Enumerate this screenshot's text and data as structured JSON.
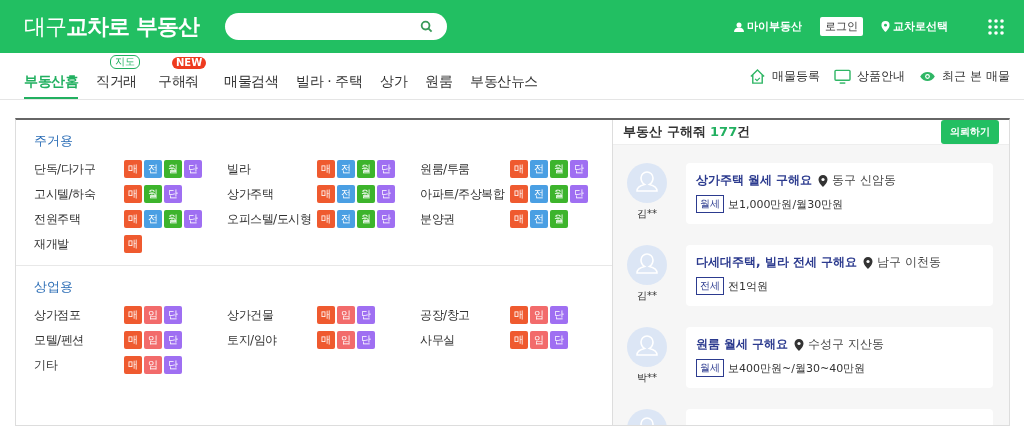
{
  "header": {
    "logo": "대구**교차로 부동산**",
    "links": [
      {
        "kind": "user",
        "label": "마이부동산"
      },
      {
        "kind": "login",
        "label": "로그인"
      },
      {
        "kind": "location",
        "label": "교차로선택"
      }
    ]
  },
  "nav": {
    "tabs": [
      {
        "label": "부동산홈",
        "selected": true
      },
      {
        "label": "직거래",
        "selected": false,
        "badge": {
          "kind": "outline",
          "text": "지도"
        }
      },
      {
        "label": "구해줘",
        "selected": false,
        "badge": {
          "kind": "new",
          "text": "NEW"
        }
      },
      {
        "label": "매물검색",
        "selected": false
      },
      {
        "label": "빌라 · 주택",
        "selected": false
      },
      {
        "label": "상가",
        "selected": false
      },
      {
        "label": "원룸",
        "selected": false
      },
      {
        "label": "부동산뉴스",
        "selected": false
      }
    ],
    "actions": [
      {
        "kind": "house",
        "label": "매물등록"
      },
      {
        "kind": "monitor",
        "label": "상품안내"
      },
      {
        "kind": "eye",
        "label": "최근 본 매물"
      }
    ]
  },
  "categories": [
    {
      "title": "주거용",
      "items": [
        {
          "label": "단독/다가구",
          "tags": [
            {
              "label": "매",
              "color": "#ef5a2f"
            },
            {
              "label": "전",
              "color": "#4a9fe3"
            },
            {
              "label": "월",
              "color": "#3db42c"
            },
            {
              "label": "단",
              "color": "#9f6ff2"
            }
          ]
        },
        {
          "label": "빌라",
          "tags": [
            {
              "label": "매",
              "color": "#ef5a2f"
            },
            {
              "label": "전",
              "color": "#4a9fe3"
            },
            {
              "label": "월",
              "color": "#3db42c"
            },
            {
              "label": "단",
              "color": "#9f6ff2"
            }
          ]
        },
        {
          "label": "원룸/투룸",
          "tags": [
            {
              "label": "매",
              "color": "#ef5a2f"
            },
            {
              "label": "전",
              "color": "#4a9fe3"
            },
            {
              "label": "월",
              "color": "#3db42c"
            },
            {
              "label": "단",
              "color": "#9f6ff2"
            }
          ]
        },
        {
          "label": "고시텔/하숙",
          "tags": [
            {
              "label": "매",
              "color": "#ef5a2f"
            },
            {
              "label": "월",
              "color": "#3db42c"
            },
            {
              "label": "단",
              "color": "#9f6ff2"
            }
          ]
        },
        {
          "label": "상가주택",
          "tags": [
            {
              "label": "매",
              "color": "#ef5a2f"
            },
            {
              "label": "전",
              "color": "#4a9fe3"
            },
            {
              "label": "월",
              "color": "#3db42c"
            },
            {
              "label": "단",
              "color": "#9f6ff2"
            }
          ]
        },
        {
          "label": "아파트/주상복합",
          "tags": [
            {
              "label": "매",
              "color": "#ef5a2f"
            },
            {
              "label": "전",
              "color": "#4a9fe3"
            },
            {
              "label": "월",
              "color": "#3db42c"
            },
            {
              "label": "단",
              "color": "#9f6ff2"
            }
          ]
        },
        {
          "label": "전원주택",
          "tags": [
            {
              "label": "매",
              "color": "#ef5a2f"
            },
            {
              "label": "전",
              "color": "#4a9fe3"
            },
            {
              "label": "월",
              "color": "#3db42c"
            },
            {
              "label": "단",
              "color": "#9f6ff2"
            }
          ]
        },
        {
          "label": "오피스텔/도시형",
          "tags": [
            {
              "label": "매",
              "color": "#ef5a2f"
            },
            {
              "label": "전",
              "color": "#4a9fe3"
            },
            {
              "label": "월",
              "color": "#3db42c"
            },
            {
              "label": "단",
              "color": "#9f6ff2"
            }
          ]
        },
        {
          "label": "분양권",
          "tags": [
            {
              "label": "매",
              "color": "#ef5a2f"
            },
            {
              "label": "전",
              "color": "#4a9fe3"
            },
            {
              "label": "월",
              "color": "#3db42c"
            }
          ]
        },
        {
          "label": "재개발",
          "tags": [
            {
              "label": "매",
              "color": "#ef5a2f"
            }
          ]
        }
      ]
    },
    {
      "title": "상업용",
      "items": [
        {
          "label": "상가점포",
          "tags": [
            {
              "label": "매",
              "color": "#ef5a2f"
            },
            {
              "label": "임",
              "color": "#f26b6b"
            },
            {
              "label": "단",
              "color": "#9f6ff2"
            }
          ]
        },
        {
          "label": "상가건물",
          "tags": [
            {
              "label": "매",
              "color": "#ef5a2f"
            },
            {
              "label": "임",
              "color": "#f26b6b"
            },
            {
              "label": "단",
              "color": "#9f6ff2"
            }
          ]
        },
        {
          "label": "공장/창고",
          "tags": [
            {
              "label": "매",
              "color": "#ef5a2f"
            },
            {
              "label": "임",
              "color": "#f26b6b"
            },
            {
              "label": "단",
              "color": "#9f6ff2"
            }
          ]
        },
        {
          "label": "모텔/펜션",
          "tags": [
            {
              "label": "매",
              "color": "#ef5a2f"
            },
            {
              "label": "임",
              "color": "#f26b6b"
            },
            {
              "label": "단",
              "color": "#9f6ff2"
            }
          ]
        },
        {
          "label": "토지/임야",
          "tags": [
            {
              "label": "매",
              "color": "#ef5a2f"
            },
            {
              "label": "임",
              "color": "#f26b6b"
            },
            {
              "label": "단",
              "color": "#9f6ff2"
            }
          ]
        },
        {
          "label": "사무실",
          "tags": [
            {
              "label": "매",
              "color": "#ef5a2f"
            },
            {
              "label": "임",
              "color": "#f26b6b"
            },
            {
              "label": "단",
              "color": "#9f6ff2"
            }
          ]
        },
        {
          "label": "기타",
          "tags": [
            {
              "label": "매",
              "color": "#ef5a2f"
            },
            {
              "label": "임",
              "color": "#f26b6b"
            },
            {
              "label": "단",
              "color": "#9f6ff2"
            }
          ]
        }
      ]
    }
  ],
  "requests": {
    "title": "부동산 구해줘",
    "count": "177",
    "unit": "건",
    "button": "의뢰하기",
    "items": [
      {
        "kind": "card",
        "name": "김**",
        "title": "상가주택 월세 구해요",
        "location": "동구 신암동",
        "type": "월세",
        "price": "보1,000만원/월30만원"
      },
      {
        "kind": "card",
        "name": "김**",
        "title": "다세대주택, 빌라 전세 구해요",
        "location": "남구 이천동",
        "type": "전세",
        "price": "전1억원"
      },
      {
        "kind": "card",
        "name": "박**",
        "title": "원룸 월세 구해요",
        "location": "수성구 지산동",
        "type": "월세",
        "price": "보400만원~/월30~40만원"
      },
      {
        "kind": "cut"
      }
    ]
  }
}
